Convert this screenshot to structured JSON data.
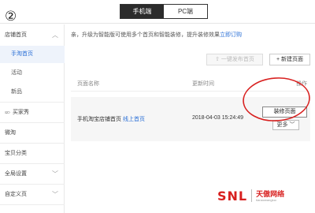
{
  "top_tabs": [
    "手机端",
    "PC端"
  ],
  "annotation_number": "②",
  "sidebar": {
    "items": [
      {
        "label": "店铺首页",
        "chevron": "︿"
      },
      {
        "label": "手淘首页"
      },
      {
        "label": "活动"
      },
      {
        "label": "新品"
      },
      {
        "label": "买家秀",
        "icon": "ဆ"
      },
      {
        "label": "微淘"
      },
      {
        "label": "宝贝分类"
      },
      {
        "label": "全局设置",
        "chevron": "﹀"
      },
      {
        "label": "自定义页",
        "chevron": "﹀"
      }
    ],
    "active_index": 1
  },
  "notice": {
    "text": "亲，升级为智能版可使用多个首页和智能装修，提升装修效果",
    "link": "立即订购"
  },
  "toolbar": {
    "publish_label": "⇧ 一键发布首页",
    "new_label": "+ 新建页面"
  },
  "table": {
    "headers": [
      "页面名称",
      "更新时间",
      "操作"
    ],
    "rows": [
      {
        "name": "手机淘宝店铺首页",
        "status_link": "线上首页",
        "updated": "2018-04-03 15:24:49",
        "action_primary": "装修页面",
        "action_more": "更多 ﹀"
      }
    ]
  },
  "watermark": {
    "logo": "SNL",
    "brand": "天傲网络",
    "sub": "tianaowangluo"
  },
  "colors": {
    "accent": "#2a6fd6",
    "highlight_circle": "#d8201f"
  }
}
